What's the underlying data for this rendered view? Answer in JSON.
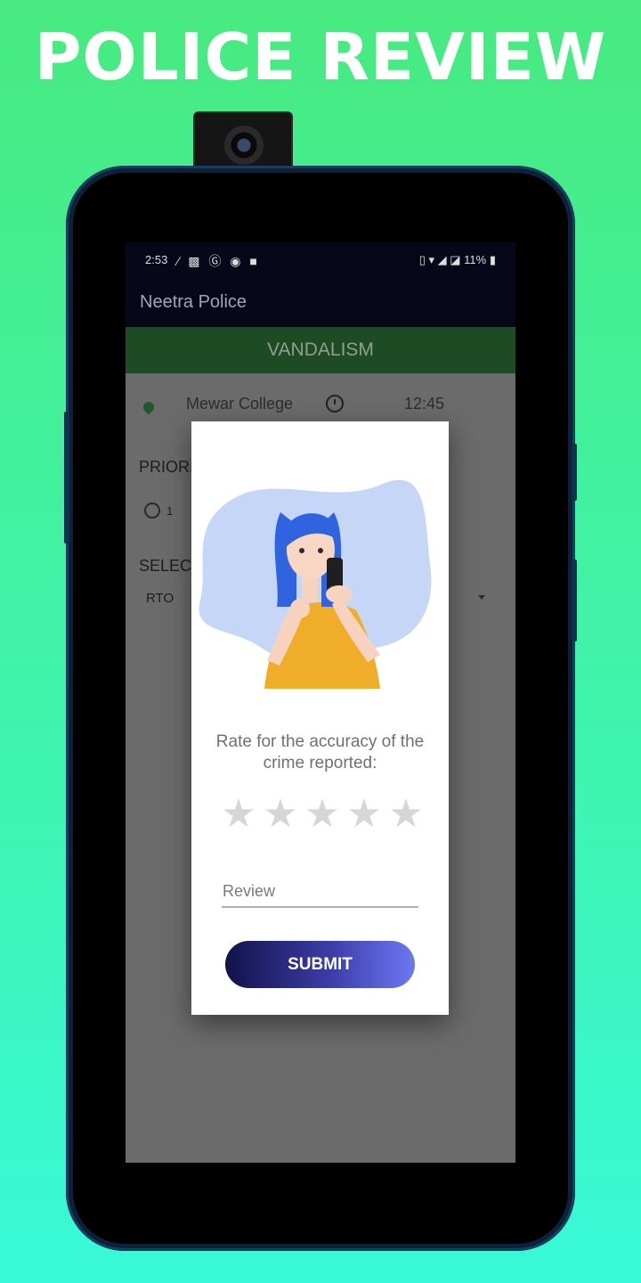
{
  "headline": "POLICE REVIEW",
  "status_bar": {
    "time": "2:53",
    "left_icons": "∕ ▩ Ⓖ ◉ ■",
    "right_text": "11%",
    "right_icons": [
      "vibrate-icon",
      "wifi-icon",
      "signal-icon",
      "battery-icon"
    ]
  },
  "app": {
    "title": "Neetra Police",
    "category": "VANDALISM",
    "location": "Mewar College",
    "location_line2": "...",
    "report_time": "12:45",
    "priority_label": "PRIORI",
    "priority_option": "1",
    "select_label": "SELECT",
    "department_value": "RTO"
  },
  "dialog": {
    "prompt": "Rate for the accuracy of the crime reported:",
    "rating": {
      "value": 0,
      "max": 5
    },
    "review_placeholder": "Review",
    "submit_label": "SUBMIT"
  },
  "colors": {
    "background_top": "#48ea80",
    "background_bottom": "#38f8d8",
    "appbar": "#06081a",
    "category_bar": "#1e4a24",
    "submit_start": "#12124a",
    "submit_end": "#6b78f2",
    "star_empty": "#d6d6d6"
  }
}
